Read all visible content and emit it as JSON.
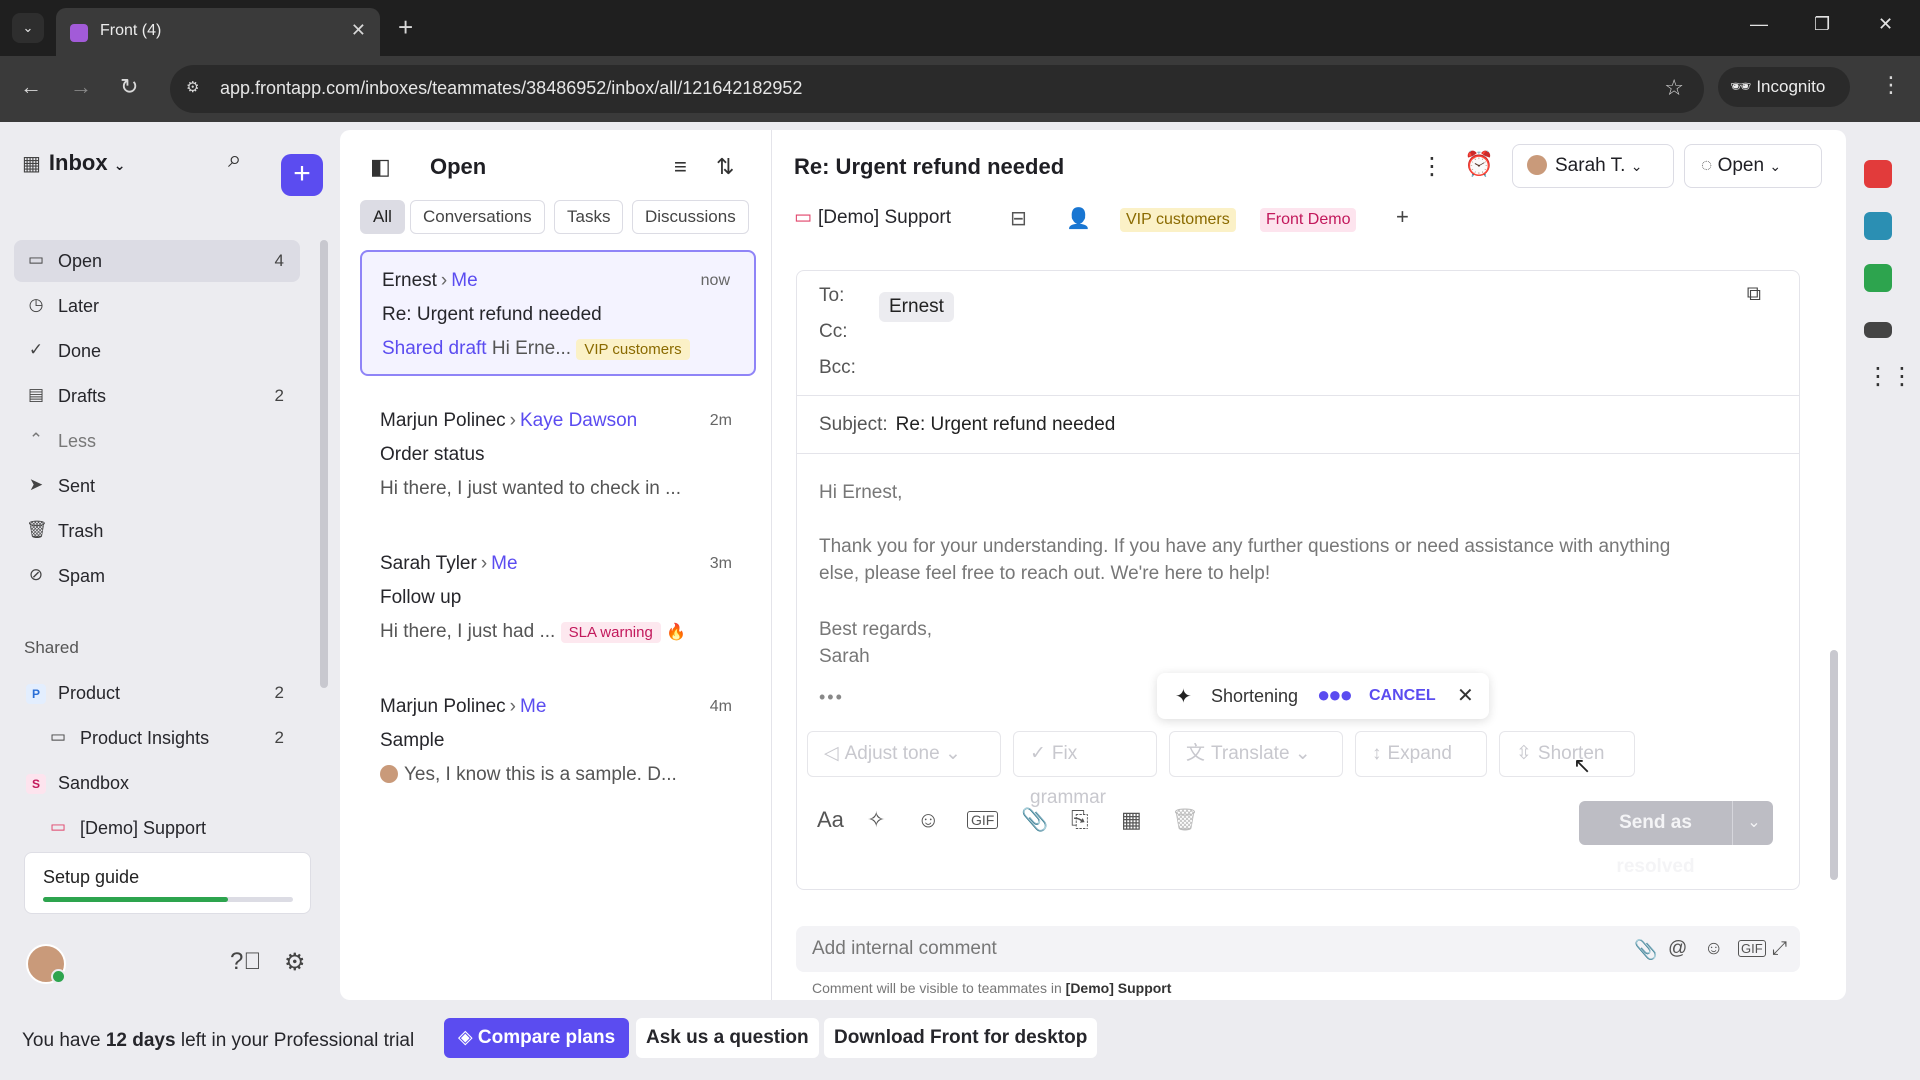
{
  "browser": {
    "tab_title": "Front (4)",
    "url": "app.frontapp.com/inboxes/teammates/38486952/inbox/all/121642182952",
    "incognito_label": "Incognito"
  },
  "sidebar": {
    "title": "Inbox",
    "items": [
      {
        "label": "Open",
        "count": "4",
        "icon": "inbox-icon"
      },
      {
        "label": "Later",
        "count": "",
        "icon": "clock-icon"
      },
      {
        "label": "Done",
        "count": "",
        "icon": "check-circle-icon"
      },
      {
        "label": "Drafts",
        "count": "2",
        "icon": "draft-icon"
      },
      {
        "label": "Less",
        "count": "",
        "icon": "chevron-up-icon"
      },
      {
        "label": "Sent",
        "count": "",
        "icon": "send-icon"
      },
      {
        "label": "Trash",
        "count": "",
        "icon": "trash-icon"
      },
      {
        "label": "Spam",
        "count": "",
        "icon": "spam-icon"
      }
    ],
    "shared_heading": "Shared",
    "shared": [
      {
        "label": "Product",
        "count": "2",
        "badge": "P"
      },
      {
        "label": "Product Insights",
        "count": "2"
      },
      {
        "label": "Sandbox",
        "count": "",
        "badge": "S"
      },
      {
        "label": "[Demo] Support",
        "count": ""
      }
    ],
    "setup_label": "Setup guide",
    "setup_progress": 0.74
  },
  "list": {
    "title": "Open",
    "filters": [
      "All",
      "Conversations",
      "Tasks",
      "Discussions"
    ],
    "conversations": [
      {
        "from": "Ernest",
        "to": "Me",
        "time": "now",
        "subject": "Re: Urgent refund needed",
        "draft_label": "Shared draft",
        "preview": "Hi Erne...",
        "tag": "VIP customers"
      },
      {
        "from": "Marjun Polinec",
        "to": "Kaye Dawson",
        "time": "2m",
        "subject": "Order status",
        "preview": "Hi there, I just wanted to check in ..."
      },
      {
        "from": "Sarah Tyler",
        "to": "Me",
        "time": "3m",
        "subject": "Follow up",
        "preview": "Hi there, I just had ...",
        "tag": "SLA warning"
      },
      {
        "from": "Marjun Polinec",
        "to": "Me",
        "time": "4m",
        "subject": "Sample",
        "preview": "Yes, I know this is a sample. D..."
      }
    ]
  },
  "message": {
    "title": "Re: Urgent refund needed",
    "assignee": "Sarah T.",
    "status": "Open",
    "inbox": "[Demo] Support",
    "tags": [
      "VIP customers",
      "Front Demo"
    ],
    "to_label": "To:",
    "to_value": "Ernest",
    "cc_label": "Cc:",
    "bcc_label": "Bcc:",
    "subject_label": "Subject:",
    "subject_value": "Re: Urgent refund needed",
    "greeting": "Hi Ernest,",
    "body_line1": "Thank you for your understanding. If you have any further questions or need assistance with anything",
    "body_line2": "else, please feel free to reach out. We're here to help!",
    "signoff": "Best regards,",
    "signature": "Sarah",
    "ai_status": "Shortening",
    "ai_cancel": "CANCEL",
    "ai_actions": [
      "Adjust tone",
      "Fix grammar",
      "Translate",
      "Expand",
      "Shorten"
    ],
    "send_label": "Send as resolved",
    "comment_placeholder": "Add internal comment",
    "comment_note": "Comment will be visible to teammates in",
    "comment_note_inbox": "[Demo] Support"
  },
  "banner": {
    "text_pre": "You have",
    "days": "12 days",
    "text_post": "left in your Professional trial",
    "compare": "Compare plans",
    "ask": "Ask us a question",
    "download": "Download Front for desktop"
  },
  "colors": {
    "accent": "#5b4cf0",
    "vip_bg": "#fbf1c7",
    "sla_bg": "#fde8ef",
    "progress": "#2da44e"
  }
}
